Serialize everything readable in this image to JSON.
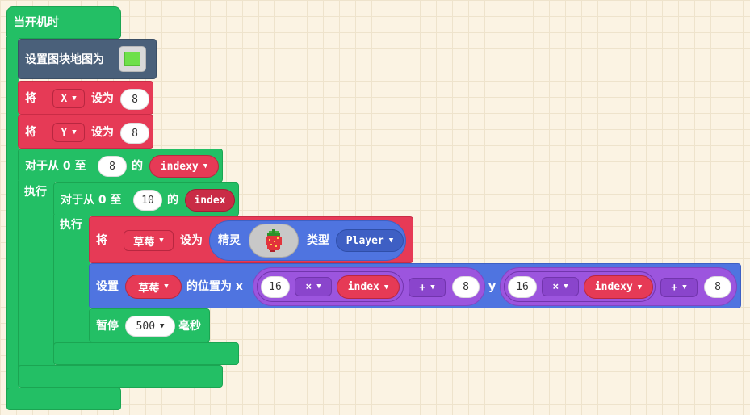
{
  "hat": {
    "label": "当开机时"
  },
  "set_tilemap": {
    "label": "设置图块地图为",
    "swatch_color": "#6ee04a"
  },
  "set_x": {
    "label_pre": "将",
    "var": "X",
    "label_mid": "设为",
    "value": "8"
  },
  "set_y": {
    "label_pre": "将",
    "var": "Y",
    "label_mid": "设为",
    "value": "8"
  },
  "outer_loop": {
    "label_pre": "对于从 0 至",
    "to_value": "8",
    "label_of": "的",
    "var": "indexy",
    "do_label": "执行"
  },
  "inner_loop": {
    "label_pre": "对于从 0 至",
    "to_value": "10",
    "label_of": "的",
    "var": "index",
    "do_label": "执行"
  },
  "set_sprite": {
    "label_pre": "将",
    "var": "草莓",
    "label_mid": "设为",
    "sprite_label": "精灵",
    "kind_label": "类型",
    "kind": "Player"
  },
  "set_position": {
    "label_pre": "设置",
    "var": "草莓",
    "label_mid": "的位置为 x",
    "x_factor": "16",
    "x_op": "×",
    "x_var": "index",
    "x_add_op": "+",
    "x_add": "8",
    "y_label": "y",
    "y_factor": "16",
    "y_op": "×",
    "y_var": "indexy",
    "y_add_op": "+",
    "y_add": "8"
  },
  "pause": {
    "label": "暂停",
    "value": "500",
    "unit": "毫秒"
  },
  "colors": {
    "loops": "#23bf65",
    "variables": "#e63a56",
    "scene": "#4a607a",
    "sprites": "#4f74e0",
    "math": "#9c55de"
  }
}
